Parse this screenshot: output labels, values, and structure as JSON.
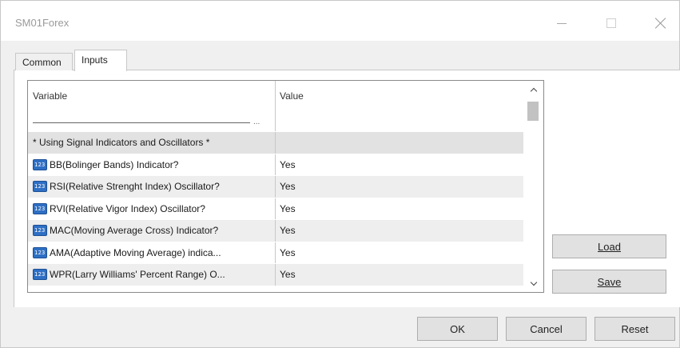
{
  "window": {
    "title": "SM01Forex"
  },
  "tabs": [
    {
      "label": "Common"
    },
    {
      "label": "Inputs"
    }
  ],
  "grid": {
    "columns": {
      "variable": "Variable",
      "value": "Value"
    },
    "header_separator_text": "___________________________________...",
    "group_label": "* Using Signal Indicators and Oscillators *",
    "rows": [
      {
        "variable": "BB(Bolinger Bands) Indicator?",
        "value": "Yes"
      },
      {
        "variable": "RSI(Relative Strenght Index) Oscillator?",
        "value": "Yes"
      },
      {
        "variable": "RVI(Relative Vigor Index) Oscillator?",
        "value": "Yes"
      },
      {
        "variable": "MAC(Moving Average Cross) Indicator?",
        "value": "Yes"
      },
      {
        "variable": "AMA(Adaptive Moving Average) indica...",
        "value": "Yes"
      },
      {
        "variable": "WPR(Larry Williams' Percent Range) O...",
        "value": "Yes"
      }
    ]
  },
  "buttons": {
    "load": "Load",
    "save": "Save",
    "ok": "OK",
    "cancel": "Cancel",
    "reset": "Reset"
  },
  "icons": {
    "row_icon": "integer-parameter-icon",
    "minimize": "minimize-icon",
    "maximize": "maximize-icon",
    "close": "close-icon"
  },
  "colors": {
    "row_icon": "#2e6fc4",
    "alt_row": "#eeeeee",
    "group_row": "#e2e2e2"
  }
}
